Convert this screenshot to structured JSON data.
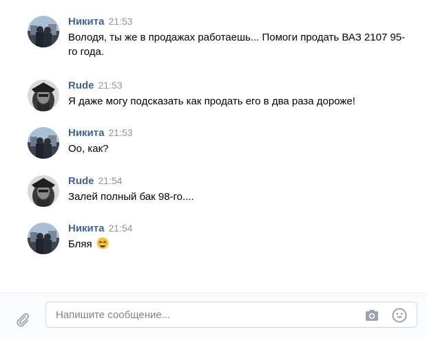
{
  "messages": [
    {
      "author": "Никита",
      "time": "21:53",
      "text": "Володя, ты же в продажах работаешь... Помоги продать ВАЗ 2107 95-го года.",
      "avatar": "nikita"
    },
    {
      "author": "Rude",
      "time": "21:53",
      "text": "Я даже могу подсказать как продать его в два раза дороже!",
      "avatar": "rude"
    },
    {
      "author": "Никита",
      "time": "21:53",
      "text": "Оо, как?",
      "avatar": "nikita"
    },
    {
      "author": "Rude",
      "time": "21:54",
      "text": "Залей полный бак 98-го....",
      "avatar": "rude"
    },
    {
      "author": "Никита",
      "time": "21:54",
      "text": "Бляя",
      "avatar": "nikita",
      "emoji": "tired-face-emoji"
    }
  ],
  "composer": {
    "placeholder": "Напишите сообщение...",
    "icons": [
      "paperclip-icon",
      "camera-icon",
      "smile-icon"
    ]
  },
  "colors": {
    "author": "#42648b",
    "time": "#939393",
    "composer_bg": "#fafbfc",
    "input_border": "#d3d9de"
  }
}
